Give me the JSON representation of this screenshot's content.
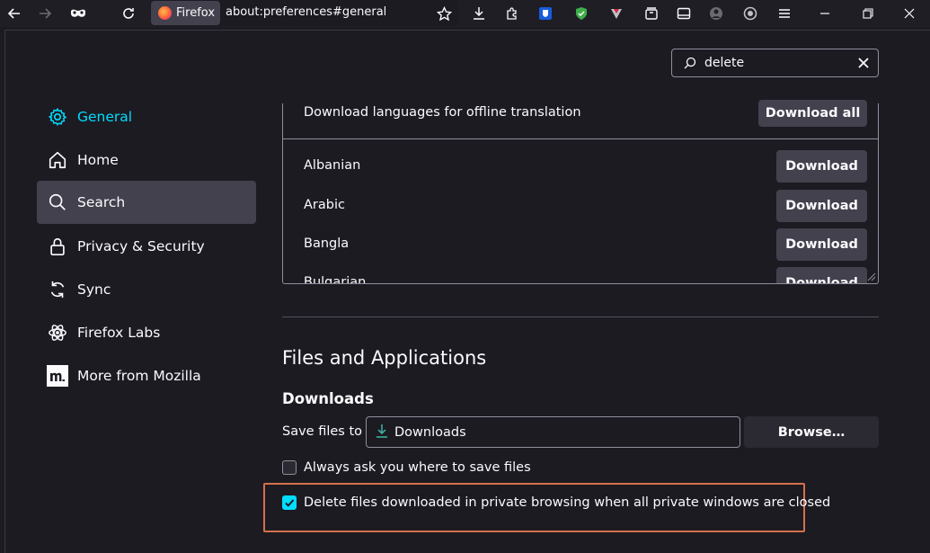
{
  "toolbar": {
    "tab_label": "Firefox",
    "url": "about:preferences#general"
  },
  "search": {
    "query": "delete"
  },
  "sidebar": {
    "items": [
      {
        "label": "General"
      },
      {
        "label": "Home"
      },
      {
        "label": "Search"
      },
      {
        "label": "Privacy & Security"
      },
      {
        "label": "Sync"
      },
      {
        "label": "Firefox Labs"
      },
      {
        "label": "More from Mozilla"
      }
    ]
  },
  "translation": {
    "offline_label": "Download languages for offline translation",
    "download_all_label": "Download all",
    "languages": [
      "Albanian",
      "Arabic",
      "Bangla",
      "Bulgarian"
    ],
    "download_label": "Download"
  },
  "files": {
    "heading": "Files and Applications",
    "downloads_heading": "Downloads",
    "save_files_label": "Save files to",
    "folder_value": "Downloads",
    "browse_label": "Browse…",
    "always_ask_label": "Always ask you where to save files",
    "always_ask_checked": false,
    "delete_private_label": "Delete files downloaded in private browsing when all private windows are closed",
    "delete_private_checked": true
  },
  "colors": {
    "accent": "#00ddff",
    "highlight_border": "#d4704a"
  }
}
